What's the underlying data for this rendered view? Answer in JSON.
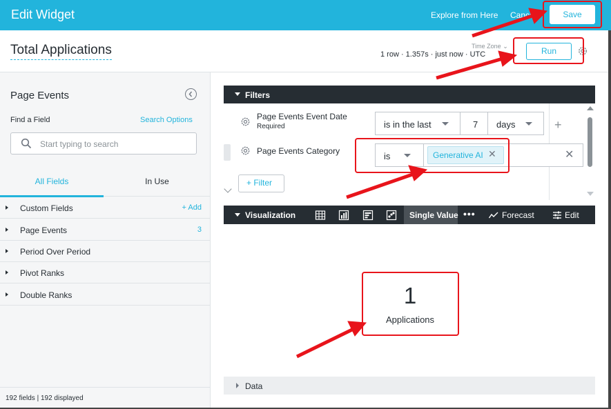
{
  "header": {
    "title": "Edit Widget",
    "explore_label": "Explore from Here",
    "cancel_label": "Cancel",
    "save_label": "Save"
  },
  "widget": {
    "title": "Total Applications",
    "time_zone_label": "Time Zone",
    "run_meta": "1 row · 1.357s · just now · UTC",
    "run_label": "Run"
  },
  "sidebar": {
    "title": "Page Events",
    "find_field_label": "Find a Field",
    "search_options_label": "Search Options",
    "search_placeholder": "Start typing to search",
    "tabs": [
      {
        "label": "All Fields",
        "active": true
      },
      {
        "label": "In Use",
        "active": false
      }
    ],
    "fields": [
      {
        "label": "Custom Fields",
        "extra": "+ Add"
      },
      {
        "label": "Page Events",
        "extra": "3"
      },
      {
        "label": "Period Over Period",
        "extra": ""
      },
      {
        "label": "Pivot Ranks",
        "extra": ""
      },
      {
        "label": "Double Ranks",
        "extra": ""
      }
    ],
    "footer_count": "192 fields | 192 displayed"
  },
  "filters": {
    "section_label": "Filters",
    "items": [
      {
        "name": "Page Events Event Date",
        "sub": "Required",
        "operator": "is in the last",
        "value": "7",
        "unit": "days"
      },
      {
        "name": "Page Events Category",
        "operator": "is",
        "chip": "Generative AI"
      }
    ],
    "add_label": "+ Filter"
  },
  "visualization": {
    "section_label": "Visualization",
    "active_type": "Single Value",
    "forecast_label": "Forecast",
    "edit_label": "Edit",
    "value": "1",
    "value_label": "Applications"
  },
  "data_section": {
    "label": "Data"
  },
  "colors": {
    "accent": "#22b4dc",
    "annotation": "#e8141b",
    "dark_bar": "#262d33"
  }
}
